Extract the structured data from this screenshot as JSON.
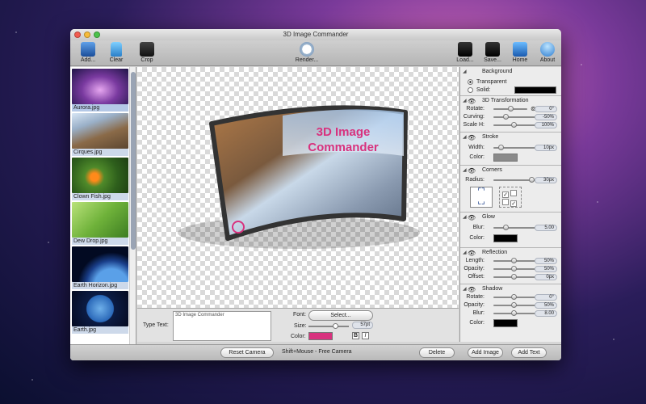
{
  "window": {
    "title": "3D Image Commander"
  },
  "toolbar": {
    "add": "Add...",
    "clear": "Clear",
    "crop": "Crop",
    "render": "Render...",
    "load": "Load...",
    "save": "Save...",
    "home": "Home",
    "about": "About"
  },
  "sidebar": {
    "items": [
      {
        "label": "Aurora.jpg"
      },
      {
        "label": "Cirques.jpg"
      },
      {
        "label": "Clown Fish.jpg"
      },
      {
        "label": "Dew Drop.jpg"
      },
      {
        "label": "Earth Horizon.jpg"
      },
      {
        "label": "Earth.jpg"
      }
    ]
  },
  "canvas": {
    "overlay_text_line1": "3D Image",
    "overlay_text_line2": "Commander"
  },
  "text_editor": {
    "type_text_label": "Type Text:",
    "text_value": "3D Image Commander",
    "font_label": "Font:",
    "select_button": "Select...",
    "size_label": "Size:",
    "size_value": "57pt",
    "color_label": "Color:",
    "bold": "B",
    "italic": "I"
  },
  "statusbar": {
    "reset_camera": "Reset Camera",
    "hint": "Shift+Mouse - Free Camera",
    "delete": "Delete",
    "add_image": "Add Image",
    "add_text": "Add Text"
  },
  "panel": {
    "background": {
      "title": "Background",
      "transparent": "Transparent",
      "solid": "Solid:"
    },
    "transform": {
      "title": "3D Transformation",
      "rotate_label": "Rotate:",
      "rotate_value": "0°",
      "curving_label": "Curving:",
      "curving_value": "-50%",
      "scaleh_label": "Scale H:",
      "scaleh_value": "100%"
    },
    "stroke": {
      "title": "Stroke",
      "width_label": "Width:",
      "width_value": "10px",
      "color_label": "Color:"
    },
    "corners": {
      "title": "Corners",
      "radius_label": "Radius:",
      "radius_value": "30px"
    },
    "glow": {
      "title": "Glow",
      "blur_label": "Blur:",
      "blur_value": "5.00",
      "color_label": "Color:"
    },
    "reflection": {
      "title": "Reflection",
      "length_label": "Length:",
      "length_value": "50%",
      "opacity_label": "Opacity:",
      "opacity_value": "50%",
      "offset_label": "Offset:",
      "offset_value": "0px"
    },
    "shadow": {
      "title": "Shadow",
      "rotate_label": "Rotate:",
      "rotate_value": "0°",
      "opacity_label": "Opacity:",
      "opacity_value": "50%",
      "blur_label": "Blur:",
      "blur_value": "8.00"
    }
  },
  "colors": {
    "accent_pink": "#d8327e",
    "stroke_color": "#8a8a8a",
    "glow_color": "#000000",
    "shadow_color": "#000000",
    "solid_bg": "#000000"
  }
}
